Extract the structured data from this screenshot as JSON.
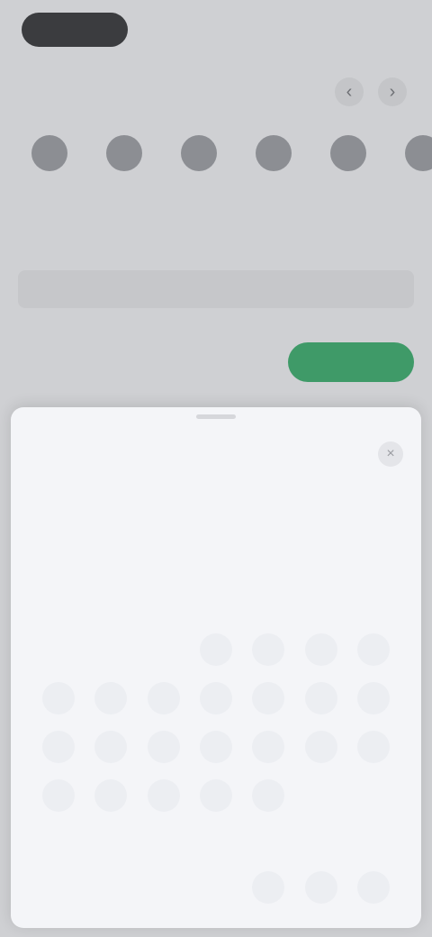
{
  "header": {
    "logo_text": "",
    "right_link": ""
  },
  "section": {
    "title": "",
    "prev_glyph": "‹",
    "next_glyph": "›"
  },
  "date_strip": [
    {
      "day": "",
      "label": ""
    },
    {
      "day": "",
      "label": ""
    },
    {
      "day": "",
      "label": ""
    },
    {
      "day": "",
      "label": ""
    },
    {
      "day": "",
      "label": ""
    },
    {
      "day": "",
      "label": ""
    }
  ],
  "range": {
    "left": "",
    "right": ""
  },
  "note": "",
  "total": {
    "label": "",
    "sub": ""
  },
  "book_button": "",
  "sheet": {
    "title": "",
    "close_glyph": "×",
    "weekdays": [
      "",
      "",
      "",
      "",
      "",
      "",
      ""
    ],
    "months": [
      {
        "title": "",
        "days": [
          {
            "n": "",
            "state": "empty"
          },
          {
            "n": "",
            "state": "empty"
          },
          {
            "n": "",
            "state": "past"
          },
          {
            "n": "",
            "state": "past"
          },
          {
            "n": "",
            "state": "past"
          },
          {
            "n": "",
            "state": "past"
          },
          {
            "n": "",
            "state": "past"
          },
          {
            "n": "",
            "state": "past"
          },
          {
            "n": "",
            "state": "past"
          },
          {
            "n": "",
            "state": "today"
          },
          {
            "n": "",
            "state": "avail"
          },
          {
            "n": "",
            "state": "avail"
          },
          {
            "n": "",
            "state": "avail"
          },
          {
            "n": "",
            "state": "avail"
          },
          {
            "n": "",
            "state": "avail"
          },
          {
            "n": "",
            "state": "avail"
          },
          {
            "n": "",
            "state": "avail"
          },
          {
            "n": "",
            "state": "avail"
          },
          {
            "n": "",
            "state": "avail"
          },
          {
            "n": "",
            "state": "avail"
          },
          {
            "n": "",
            "state": "avail"
          },
          {
            "n": "",
            "state": "avail"
          },
          {
            "n": "",
            "state": "avail"
          },
          {
            "n": "",
            "state": "avail"
          },
          {
            "n": "",
            "state": "avail"
          },
          {
            "n": "",
            "state": "avail"
          },
          {
            "n": "",
            "state": "avail"
          },
          {
            "n": "",
            "state": "avail"
          },
          {
            "n": "",
            "state": "avail"
          },
          {
            "n": "",
            "state": "avail"
          },
          {
            "n": "",
            "state": "avail"
          },
          {
            "n": "",
            "state": "avail"
          },
          {
            "n": "",
            "state": "avail"
          }
        ]
      },
      {
        "title": "",
        "days": [
          {
            "n": "",
            "state": "empty"
          },
          {
            "n": "",
            "state": "empty"
          },
          {
            "n": "",
            "state": "empty"
          },
          {
            "n": "",
            "state": "empty"
          },
          {
            "n": "",
            "state": "avail"
          },
          {
            "n": "",
            "state": "avail"
          },
          {
            "n": "",
            "state": "avail"
          }
        ]
      }
    ]
  },
  "colors": {
    "accent_green": "#3f9a68",
    "today_red": "#e07a72",
    "overlay": "#cfd0d3",
    "sheet_bg": "#f4f5f8"
  }
}
